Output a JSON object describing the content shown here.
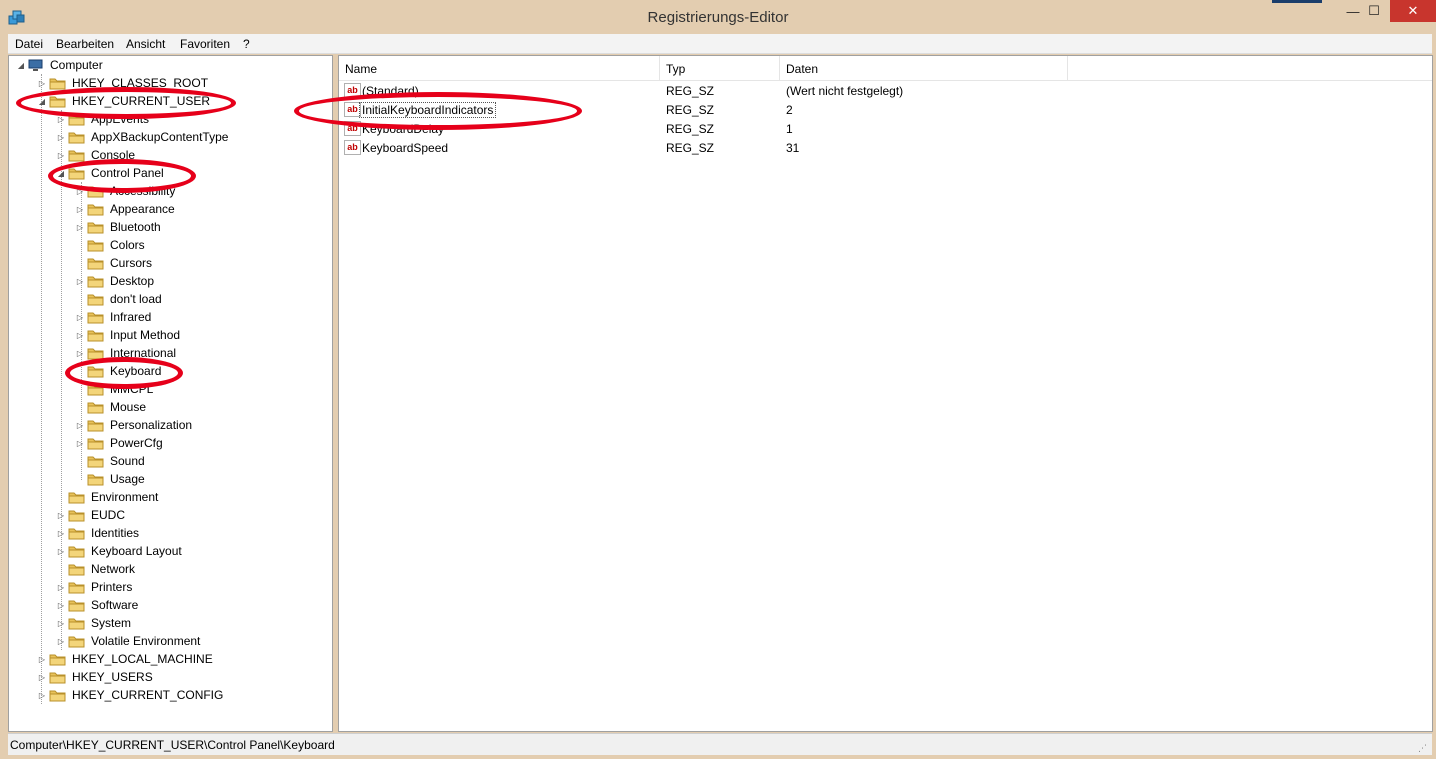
{
  "window": {
    "title": "Registrierungs-Editor",
    "min_glyph": "—",
    "max_glyph": "☐",
    "close_glyph": "✕"
  },
  "menu": [
    "Datei",
    "Bearbeiten",
    "Ansicht",
    "Favoriten",
    "?"
  ],
  "tree": {
    "root": "Computer",
    "hives": [
      "HKEY_CLASSES_ROOT",
      "HKEY_CURRENT_USER",
      "HKEY_LOCAL_MACHINE",
      "HKEY_USERS",
      "HKEY_CURRENT_CONFIG"
    ],
    "hkcu_children": [
      "AppEvents",
      "AppXBackupContentType",
      "Console",
      "Control Panel",
      "Environment",
      "EUDC",
      "Identities",
      "Keyboard Layout",
      "Network",
      "Printers",
      "Software",
      "System",
      "Volatile Environment"
    ],
    "control_panel_children": [
      "Accessibility",
      "Appearance",
      "Bluetooth",
      "Colors",
      "Cursors",
      "Desktop",
      "don't load",
      "Infrared",
      "Input Method",
      "International",
      "Keyboard",
      "MMCPL",
      "Mouse",
      "Personalization",
      "PowerCfg",
      "Sound",
      "Usage"
    ]
  },
  "list": {
    "columns": [
      "Name",
      "Typ",
      "Daten"
    ],
    "rows": [
      {
        "name": "(Standard)",
        "type": "REG_SZ",
        "data": "(Wert nicht festgelegt)"
      },
      {
        "name": "InitialKeyboardIndicators",
        "type": "REG_SZ",
        "data": "2"
      },
      {
        "name": "KeyboardDelay",
        "type": "REG_SZ",
        "data": "1"
      },
      {
        "name": "KeyboardSpeed",
        "type": "REG_SZ",
        "data": "31"
      }
    ],
    "value_icon_text": "ab"
  },
  "status": {
    "path": "Computer\\HKEY_CURRENT_USER\\Control Panel\\Keyboard"
  },
  "colors": {
    "annotation": "#e6001a",
    "close_button": "#c8352d",
    "title_bar": "#e3cdb0"
  }
}
